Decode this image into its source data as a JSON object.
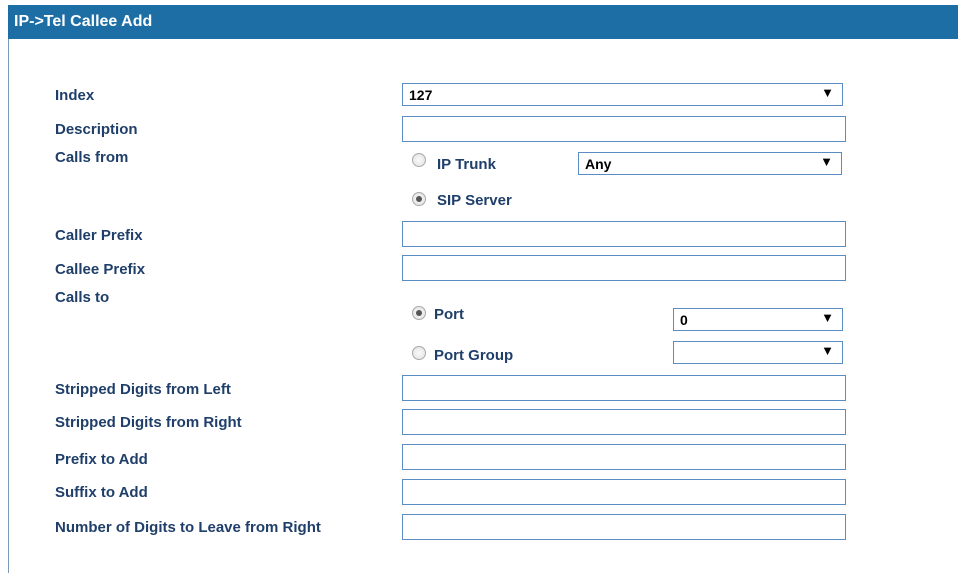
{
  "title": "IP->Tel Callee Add",
  "fields": {
    "index": {
      "label": "Index",
      "value": "127"
    },
    "description": {
      "label": "Description",
      "value": ""
    },
    "calls_from": {
      "label": "Calls from",
      "ip_trunk": {
        "label": "IP Trunk",
        "checked": false,
        "select_value": "Any"
      },
      "sip_server": {
        "label": "SIP Server",
        "checked": true
      }
    },
    "caller_prefix": {
      "label": "Caller Prefix",
      "value": ""
    },
    "callee_prefix": {
      "label": "Callee Prefix",
      "value": ""
    },
    "calls_to": {
      "label": "Calls to",
      "port": {
        "label": "Port",
        "checked": true,
        "select_value": "0"
      },
      "port_group": {
        "label": "Port Group",
        "checked": false,
        "select_value": ""
      }
    },
    "stripped_left": {
      "label": "Stripped Digits from Left",
      "value": ""
    },
    "stripped_right": {
      "label": "Stripped Digits from Right",
      "value": ""
    },
    "prefix_add": {
      "label": "Prefix to Add",
      "value": ""
    },
    "suffix_add": {
      "label": "Suffix to Add",
      "value": ""
    },
    "digits_leave": {
      "label": "Number of Digits to Leave from Right",
      "value": ""
    }
  },
  "icons": {
    "dropdown": "▼"
  },
  "colors": {
    "title_bar": "#1e6ea6",
    "label_text": "#1f3f6a",
    "input_border": "#5b8cc3"
  }
}
